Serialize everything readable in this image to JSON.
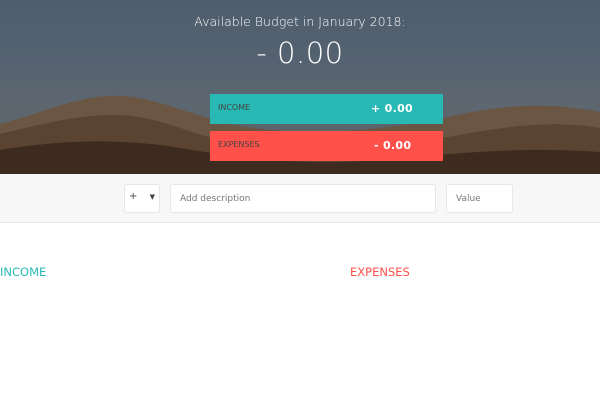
{
  "header": {
    "budget_title": "Available Budget in January 2018:",
    "budget_value": "- 0.00",
    "income": {
      "label": "INCOME",
      "value": "+ 0.00"
    },
    "expenses": {
      "label": "EXPENSES",
      "value": "- 0.00",
      "percentage": "---"
    }
  },
  "add_form": {
    "type_options": [
      "+",
      "-"
    ],
    "type_selected": "+",
    "type_caret": "▼",
    "description_placeholder": "Add description",
    "value_placeholder": "Value"
  },
  "lists": {
    "income_title": "INCOME",
    "expenses_title": "EXPENSES",
    "income_items": [],
    "expenses_items": []
  },
  "colors": {
    "income": "#28b9b5",
    "expenses": "#ff5049"
  }
}
